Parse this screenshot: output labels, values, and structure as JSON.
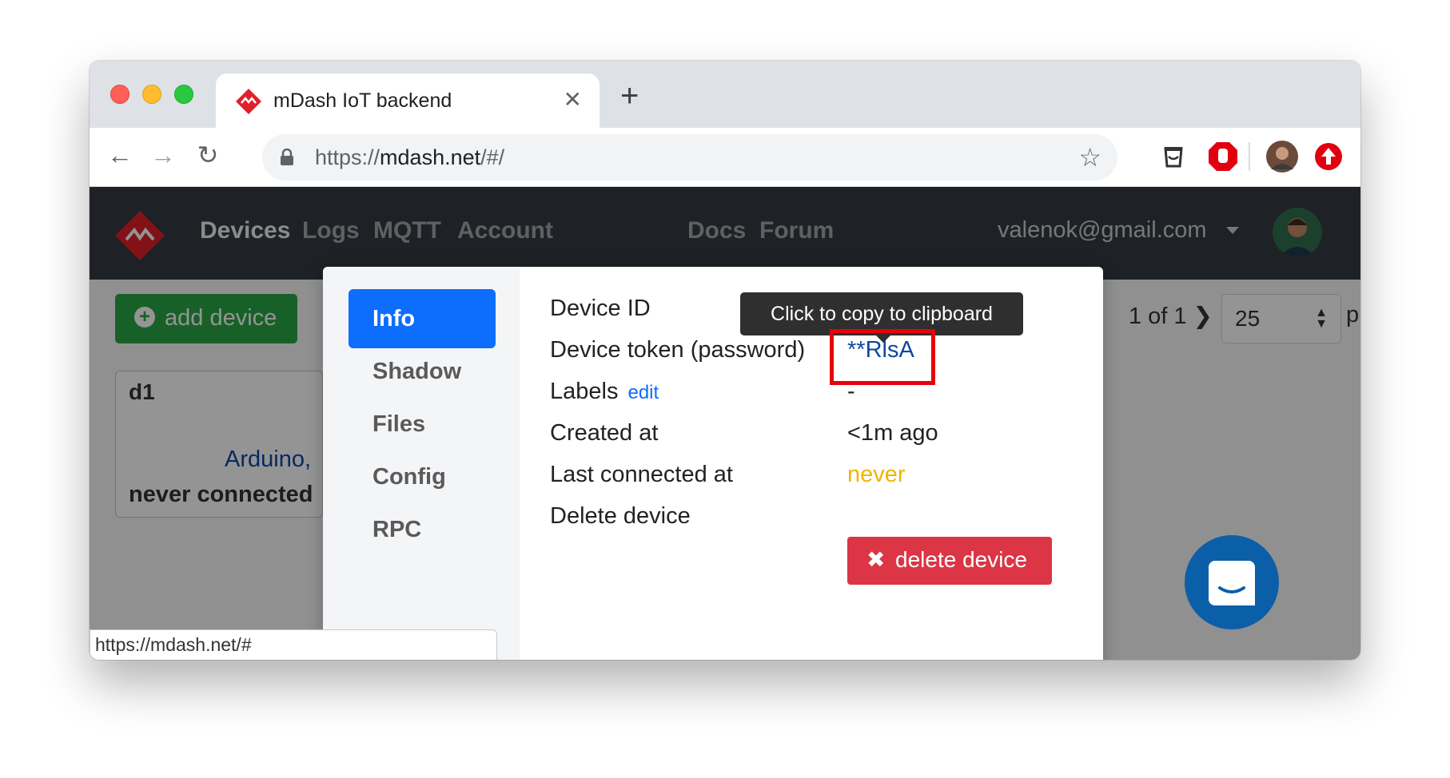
{
  "browser": {
    "tab_title": "mDash IoT backend",
    "tab_close": "✕",
    "new_tab": "+",
    "back": "←",
    "forward": "→",
    "reload": "↻",
    "url_scheme": "https://",
    "url_host": "mdash.net",
    "url_path": "/#/",
    "bookmark": "☆",
    "status_url": "https://mdash.net/#"
  },
  "nav": {
    "links": [
      "Devices",
      "Logs",
      "MQTT",
      "Account"
    ],
    "right_links": [
      "Docs",
      "Forum"
    ],
    "user_email": "valenok@gmail.com"
  },
  "toolbar": {
    "add_device_label": "add device",
    "add_device_icon": "+",
    "pager_text": "1 of 1",
    "pager_next": "❯",
    "per_page": "25",
    "per_page_arrows": "▲▼",
    "per_page_tail": "p"
  },
  "device_card": {
    "name": "d1",
    "platform": "Arduino,",
    "state": "never connected"
  },
  "modal": {
    "tabs": [
      "Info",
      "Shadow",
      "Files",
      "Config",
      "RPC"
    ],
    "active_tab": "Info",
    "rows": {
      "device_id_label": "Device ID",
      "token_label": "Device token (password)",
      "token_value": "**RlsA",
      "labels_label": "Labels",
      "labels_edit": "edit",
      "labels_value": "-",
      "created_label": "Created at",
      "created_value": "<1m ago",
      "last_connected_label": "Last connected at",
      "last_connected_value": "never",
      "delete_label": "Delete device"
    },
    "delete_button": "delete device",
    "delete_icon": "✖",
    "tooltip": "Click to copy to clipboard"
  },
  "colors": {
    "primary": "#0d6efd",
    "danger": "#dc3545",
    "success": "#28a745",
    "warning": "#f0b400",
    "highlight": "#e8000b",
    "navbar": "#343a40"
  },
  "icons": [
    "mdash-logo-icon",
    "lock-icon",
    "star-icon",
    "ghostery-icon",
    "adblock-icon",
    "profile-avatar-icon",
    "update-icon",
    "chat-icon"
  ]
}
